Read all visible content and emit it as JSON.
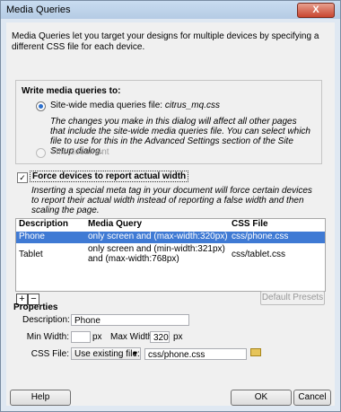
{
  "window": {
    "title": "Media Queries",
    "close_label": "X"
  },
  "intro": "Media Queries let you target your designs for multiple devices by specifying a different CSS file for each device.",
  "write_group": {
    "title": "Write media queries to:",
    "option_sitewide_prefix": "Site-wide media queries file:",
    "option_sitewide_file": "citrus_mq.css",
    "note": "The changes you make in this dialog will affect all other pages that include the site-wide media queries file. You can select which file to use for this in the Advanced Settings section of the Site Setup dialog.",
    "option_document": "This document"
  },
  "force": {
    "checked": true,
    "label": "Force devices to report actual width",
    "note": "Inserting a special meta tag in your document will force certain devices to report their actual width instead of reporting a false width and then scaling the page."
  },
  "table": {
    "headers": [
      "Description",
      "Media Query",
      "CSS File"
    ],
    "rows": [
      {
        "description": "Phone",
        "query": "only screen and (max-width:320px)",
        "css": "css/phone.css",
        "selected": true
      },
      {
        "description": "Tablet",
        "query": "only screen and (min-width:321px) and (max-width:768px)",
        "css": "css/tablet.css",
        "selected": false
      }
    ],
    "add_label": "+",
    "remove_label": "−",
    "default_presets_label": "Default Presets"
  },
  "properties": {
    "title": "Properties",
    "description_label": "Description:",
    "description_value": "Phone",
    "min_width_label": "Min Width:",
    "min_width_value": "",
    "min_unit": "px",
    "max_width_label": "Max Width:",
    "max_width_value": "320",
    "max_unit": "px",
    "css_file_label": "CSS File:",
    "css_file_option": "Use existing file:",
    "css_file_value": "css/phone.css"
  },
  "buttons": {
    "help": "Help",
    "ok": "OK",
    "cancel": "Cancel"
  }
}
